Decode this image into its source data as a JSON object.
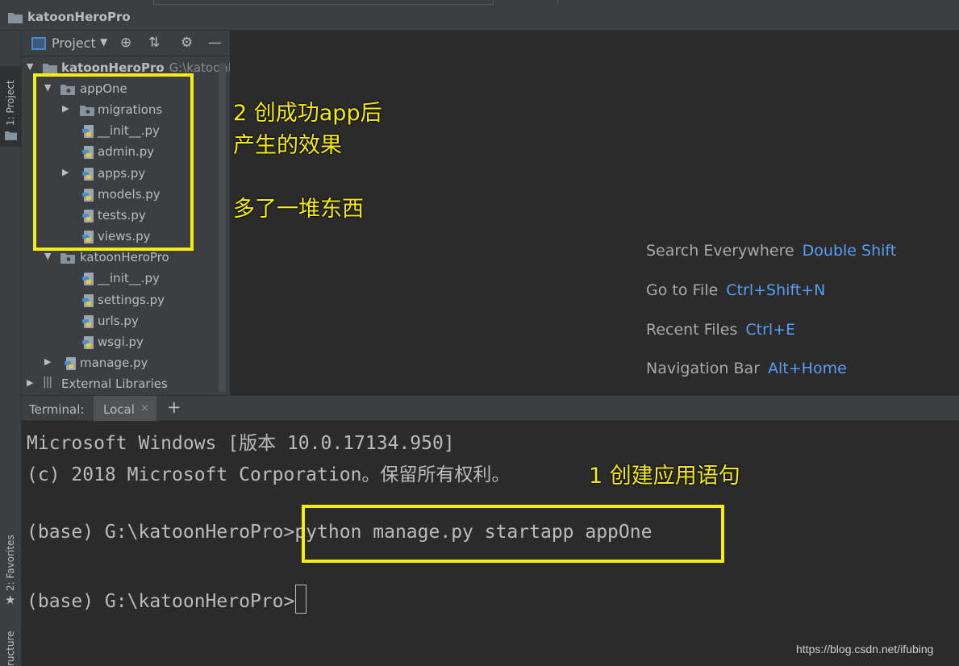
{
  "window": {
    "title": "katoonHeroPro"
  },
  "left_strip": {
    "project_tab": "1: Project",
    "favorites_tab": "2: Favorites",
    "structure_tab": "ructure"
  },
  "project_panel": {
    "view_label": "Project",
    "tree": [
      {
        "label": "katoonHeroPro",
        "hint": "G:\\katoonH",
        "kind": "root",
        "expanded": true
      },
      {
        "label": "appOne",
        "kind": "package",
        "expanded": true
      },
      {
        "label": "migrations",
        "kind": "package",
        "expanded": false
      },
      {
        "label": "__init__.py",
        "kind": "py"
      },
      {
        "label": "admin.py",
        "kind": "py"
      },
      {
        "label": "apps.py",
        "kind": "py",
        "expandable": true
      },
      {
        "label": "models.py",
        "kind": "py"
      },
      {
        "label": "tests.py",
        "kind": "py"
      },
      {
        "label": "views.py",
        "kind": "py"
      },
      {
        "label": "katoonHeroPro",
        "kind": "package",
        "expanded": true
      },
      {
        "label": "__init__.py",
        "kind": "py"
      },
      {
        "label": "settings.py",
        "kind": "py"
      },
      {
        "label": "urls.py",
        "kind": "py"
      },
      {
        "label": "wsgi.py",
        "kind": "py"
      },
      {
        "label": "manage.py",
        "kind": "py",
        "expandable": true
      },
      {
        "label": "External Libraries",
        "kind": "libs",
        "expandable": true
      }
    ]
  },
  "editor_hints": [
    {
      "text": "Search Everywhere",
      "key": "Double Shift"
    },
    {
      "text": "Go to File",
      "key": "Ctrl+Shift+N"
    },
    {
      "text": "Recent Files",
      "key": "Ctrl+E"
    },
    {
      "text": "Navigation Bar",
      "key": "Alt+Home"
    }
  ],
  "terminal": {
    "label": "Terminal:",
    "tab": "Local",
    "close": "×",
    "add": "+",
    "lines": [
      "Microsoft Windows [版本 10.0.17134.950]",
      "(c) 2018 Microsoft Corporation。保留所有权利。",
      "(base) G:\\katoonHeroPro>python manage.py startapp appOne",
      "(base) G:\\katoonHeroPro>"
    ]
  },
  "annotations": {
    "a2_line1": "2 创成功app后",
    "a2_line2": "产生的效果",
    "a3": "多了一堆东西",
    "a1": "1 创建应用语句"
  },
  "watermark": "https://blog.csdn.net/ifubing",
  "colors": {
    "highlight": "#f5ec14",
    "shortcut": "#589df6",
    "background": "#2b2b2b",
    "panel": "#3c3f41"
  }
}
